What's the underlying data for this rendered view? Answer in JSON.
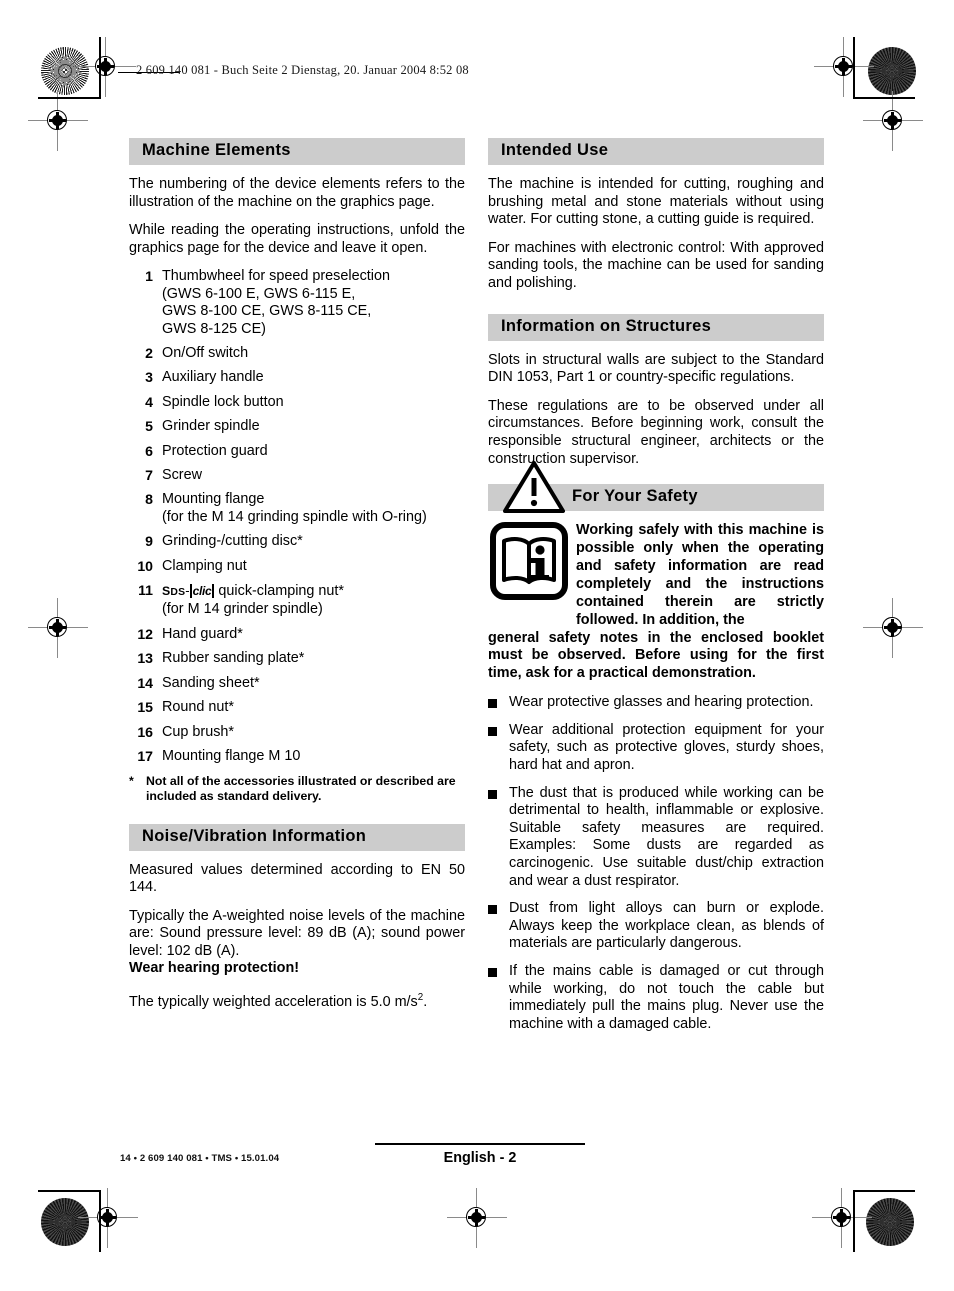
{
  "document": {
    "header_line": "2 609 140 081 - Buch  Seite 2  Dienstag, 20. Januar 2004  8:52 08",
    "footer_code": "14 • 2 609 140 081 • TMS • 15.01.04",
    "footer_page": "English - 2"
  },
  "machine_elements": {
    "heading": "Machine Elements",
    "intro_1": "The numbering of the device elements refers to the illustration of the machine on the graphics page.",
    "intro_2": "While reading the operating instructions, unfold the graphics page for the device and leave it open.",
    "items": [
      {
        "num": "1",
        "label": "Thumbwheel for speed preselection",
        "lines": [
          "(GWS 6-100 E, GWS 6-115 E,",
          "GWS 8-100 CE, GWS 8-115 CE,",
          "GWS 8-125 CE)"
        ]
      },
      {
        "num": "2",
        "label": "On/Off switch",
        "lines": []
      },
      {
        "num": "3",
        "label": "Auxiliary handle",
        "lines": []
      },
      {
        "num": "4",
        "label": "Spindle lock button",
        "lines": []
      },
      {
        "num": "5",
        "label": "Grinder spindle",
        "lines": []
      },
      {
        "num": "6",
        "label": "Protection guard",
        "lines": []
      },
      {
        "num": "7",
        "label": "Screw",
        "lines": []
      },
      {
        "num": "8",
        "label": "Mounting flange",
        "lines": [
          "(for the M 14 grinding spindle with O-ring)"
        ]
      },
      {
        "num": "9",
        "label": "Grinding-/cutting disc*",
        "lines": []
      },
      {
        "num": "10",
        "label": "Clamping nut",
        "lines": []
      },
      {
        "num": "11",
        "label": "quick-clamping nut*",
        "logo": "SDS-clic",
        "lines": [
          "(for M 14 grinder spindle)"
        ]
      },
      {
        "num": "12",
        "label": "Hand guard*",
        "lines": []
      },
      {
        "num": "13",
        "label": "Rubber sanding plate*",
        "lines": []
      },
      {
        "num": "14",
        "label": "Sanding sheet*",
        "lines": []
      },
      {
        "num": "15",
        "label": "Round nut*",
        "lines": []
      },
      {
        "num": "16",
        "label": "Cup brush*",
        "lines": []
      },
      {
        "num": "17",
        "label": "Mounting flange M 10",
        "lines": []
      }
    ],
    "footnote_marker": "*",
    "footnote": "Not all of the accessories illustrated or described are included as standard delivery."
  },
  "noise_vibration": {
    "heading": "Noise/Vibration Information",
    "para_1": "Measured values determined according to EN 50 144.",
    "para_2_a": "Typically the A-weighted noise levels of the machine are: Sound pressure level: 89 dB (A); sound power level: 102 dB (A).",
    "para_2_b": "Wear hearing protection!",
    "para_3_prefix": "The typically weighted acceleration is 5.0 m/s",
    "para_3_exponent": "2",
    "para_3_suffix": "."
  },
  "intended_use": {
    "heading": "Intended Use",
    "para_1": "The machine is intended for cutting, roughing and brushing metal and stone materials without using water. For cutting stone, a cutting guide is required.",
    "para_2": "For machines with electronic control: With approved sanding tools, the machine can be used for sanding and polishing."
  },
  "information_on_structures": {
    "heading": "Information on Structures",
    "para_1": "Slots in structural walls are subject to the Standard DIN 1053, Part 1 or country-specific regulations.",
    "para_2": "These regulations are to be observed under all circumstances. Before beginning work, consult the responsible structural engineer, architects or the construction supervisor."
  },
  "for_your_safety": {
    "heading": "For Your Safety",
    "intro_indented": "Working safely with this machine is possible only when the operating and safety information are read completely and the instructions contained therein are strictly followed. In addition, the",
    "intro_full": "general safety notes in the enclosed booklet must be observed. Before using for the first time, ask for a practical demonstration.",
    "bullets": [
      "Wear protective glasses and hearing protection.",
      "Wear additional protection equipment for your safety, such as protective gloves, sturdy shoes, hard hat and apron.",
      "The dust that is produced while working can be detrimental to health, inflammable or explosive. Suitable safety measures are required. Examples: Some dusts are regarded as carcinogenic. Use suitable dust/chip extraction and wear a dust respirator.",
      "Dust from light alloys can burn or explode. Always keep the workplace clean, as blends of materials are particularly dangerous.",
      "If the mains cable is damaged or cut through while working, do not touch the cable but immediately pull the mains plug. Never use the machine with a damaged cable."
    ]
  },
  "colors": {
    "heading_bar": "#cccccc",
    "text": "#000000",
    "page_background": "#ffffff"
  }
}
